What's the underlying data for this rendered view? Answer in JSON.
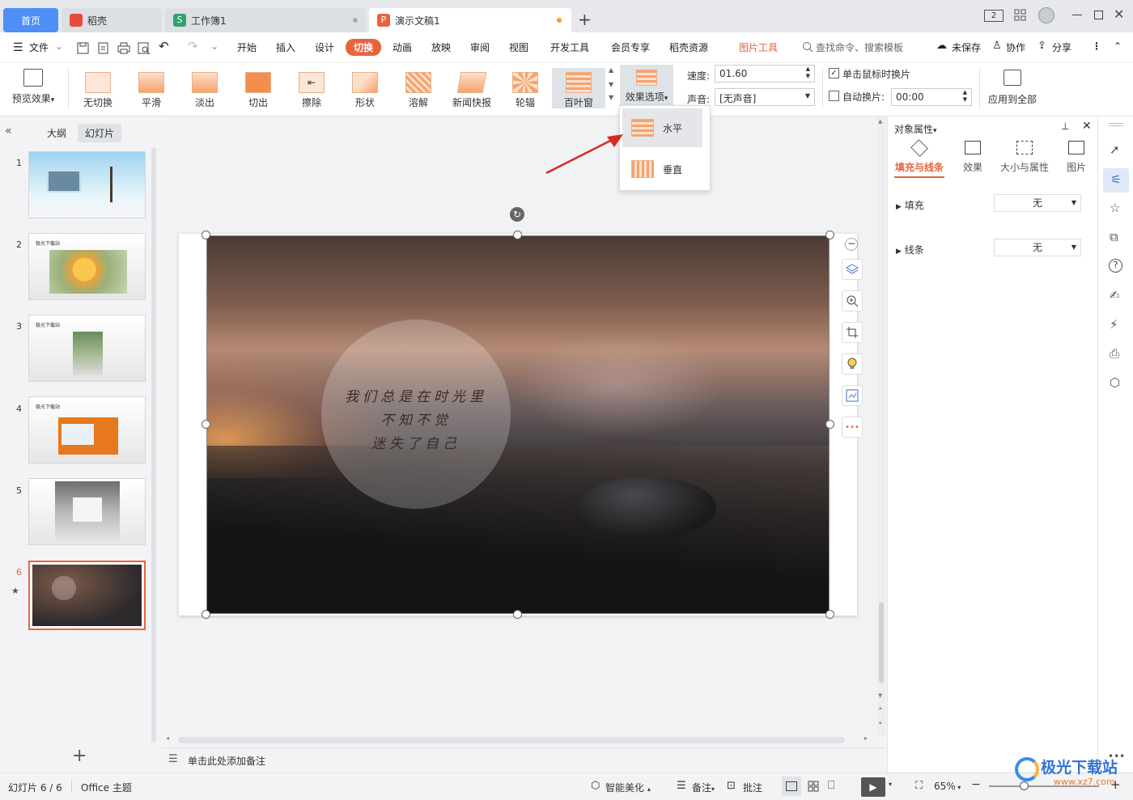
{
  "tabs": {
    "home": "首页",
    "daoke": "稻壳",
    "workbook": "工作簿1",
    "presentation": "演示文稿1"
  },
  "window": {
    "page_badge": "2"
  },
  "menu": {
    "file": "文件",
    "start": "开始",
    "insert": "插入",
    "design": "设计",
    "transition": "切换",
    "animation": "动画",
    "slideshow": "放映",
    "review": "审阅",
    "view": "视图",
    "devtools": "开发工具",
    "vip": "会员专享",
    "resources": "稻壳资源",
    "picture_tools": "图片工具",
    "search_placeholder": "查找命令、搜索模板",
    "unsaved": "未保存",
    "collab": "协作",
    "share": "分享"
  },
  "ribbon": {
    "preview": "预览效果",
    "transitions": [
      "无切换",
      "平滑",
      "淡出",
      "切出",
      "擦除",
      "形状",
      "溶解",
      "新闻快报",
      "轮辐",
      "百叶窗"
    ],
    "effect_options": "效果选项",
    "speed_label": "速度:",
    "speed_value": "01.60",
    "sound_label": "声音:",
    "sound_value": "[无声音]",
    "on_click_label": "单击鼠标时换片",
    "auto_label": "自动换片:",
    "auto_value": "00:00",
    "apply_all": "应用到全部"
  },
  "dropdown": {
    "horizontal": "水平",
    "vertical": "垂直"
  },
  "leftpanel": {
    "outline_tab": "大纲",
    "slides_tab": "幻灯片",
    "thumb_caption": "极光下载站",
    "slide_numbers": [
      "1",
      "2",
      "3",
      "4",
      "5",
      "6"
    ]
  },
  "slide": {
    "lines": [
      "我们总是在时光里",
      "不知不觉",
      "迷失了自己"
    ]
  },
  "rightpanel": {
    "title": "对象属性",
    "tabs": [
      "填充与线条",
      "效果",
      "大小与属性",
      "图片"
    ],
    "fill_label": "填充",
    "fill_value": "无",
    "line_label": "线条",
    "line_value": "无"
  },
  "notes": {
    "placeholder": "单击此处添加备注"
  },
  "statusbar": {
    "slide_count": "幻灯片 6 / 6",
    "theme": "Office 主题",
    "beautify": "智能美化",
    "notes": "备注",
    "comments": "批注",
    "zoom": "65%"
  },
  "watermark": {
    "text": "极光下载站",
    "url": "www.xz7.com"
  },
  "colors": {
    "accent": "#e8643c",
    "tab_active": "#4e8ef7"
  }
}
